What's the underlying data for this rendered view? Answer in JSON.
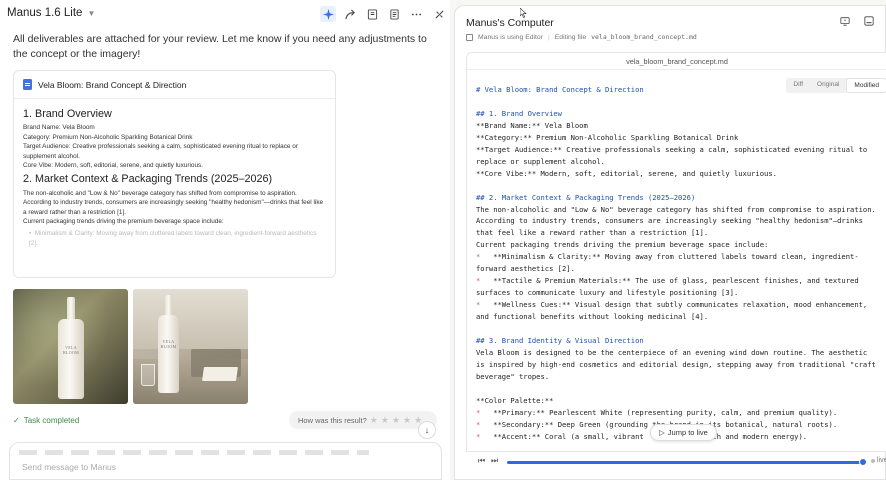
{
  "header": {
    "app_name": "Manus 1.6 Lite",
    "icons": [
      "sparkle-icon",
      "share-icon",
      "bookmark-icon",
      "document-icon",
      "more-icon",
      "collapse-icon"
    ]
  },
  "chat": {
    "message": "All deliverables are attached for your review. Let me know if you need any adjustments to the concept or the imagery!",
    "card": {
      "title": "Vela Bloom: Brand Concept & Direction",
      "sections": [
        {
          "heading": "1. Brand Overview",
          "lines": [
            "Brand Name: Vela Bloom",
            "Category: Premium Non-Alcoholic Sparkling Botanical Drink",
            "Target Audience: Creative professionals seeking a calm, sophisticated evening ritual to replace or supplement alcohol.",
            "Core Vibe: Modern, soft, editorial, serene, and quietly luxurious."
          ]
        },
        {
          "heading": "2. Market Context & Packaging Trends (2025–2026)",
          "lines": [
            "The non-alcoholic and \"Low & No\" beverage category has shifted from compromise to aspiration. According to industry trends, consumers are increasingly seeking \"healthy hedonism\"—drinks that feel like a reward rather than a restriction [1].",
            "Current packaging trends driving the premium beverage space include:"
          ],
          "fade_line": "Minimalism & Clarity: Moving away from cluttered labels toward clean, ingredient-forward aesthetics [2]."
        }
      ]
    },
    "bottle_label": "VELA BLOOM",
    "status": "Task completed",
    "rating_prompt": "How was this result?",
    "stars": 5,
    "composer_placeholder": "Send message to Manus"
  },
  "computer": {
    "title": "Manus's Computer",
    "status_app": "Manus is using Editor",
    "status_action": "Editing file",
    "status_file": "vela_bloom_brand_concept.md",
    "file_name": "vela_bloom_brand_concept.md",
    "tabs": [
      "Diff",
      "Original",
      "Modified"
    ],
    "active_tab": "Modified",
    "code_lines": [
      {
        "t": "# Vela Bloom: Brand Concept & Direction",
        "c": "h"
      },
      {
        "t": "",
        "c": ""
      },
      {
        "t": "## 1. Brand Overview",
        "c": "h"
      },
      {
        "t": "**Brand Name:** Vela Bloom",
        "c": ""
      },
      {
        "t": "**Category:** Premium Non-Alcoholic Sparkling Botanical Drink",
        "c": ""
      },
      {
        "t": "**Target Audience:** Creative professionals seeking a calm, sophisticated evening ritual to",
        "c": ""
      },
      {
        "t": "replace or supplement alcohol.",
        "c": ""
      },
      {
        "t": "**Core Vibe:** Modern, soft, editorial, serene, and quietly luxurious.",
        "c": ""
      },
      {
        "t": "",
        "c": ""
      },
      {
        "t": "## 2. Market Context & Packaging Trends (2025–2026)",
        "c": "h"
      },
      {
        "t": "The non-alcoholic and \"Low & No\" beverage category has shifted from compromise to aspiration.",
        "c": ""
      },
      {
        "t": "According to industry trends, consumers are increasingly seeking \"healthy hedonism\"—drinks",
        "c": ""
      },
      {
        "t": "that feel like a reward rather than a restriction [1].",
        "c": ""
      },
      {
        "t": "Current packaging trends driving the premium beverage space include:",
        "c": ""
      },
      {
        "t": "*   **Minimalism & Clarity:** Moving away from cluttered labels toward clean, ingredient-",
        "c": "bl"
      },
      {
        "t": "forward aesthetics [2].",
        "c": ""
      },
      {
        "t": "*   **Tactile & Premium Materials:** The use of glass, pearlescent finishes, and textured",
        "c": "bl"
      },
      {
        "t": "surfaces to communicate luxury and lifestyle positioning [3].",
        "c": ""
      },
      {
        "t": "*   **Wellness Cues:** Visual design that subtly communicates relaxation, mood enhancement,",
        "c": "bl"
      },
      {
        "t": "and functional benefits without looking medicinal [4].",
        "c": ""
      },
      {
        "t": "",
        "c": ""
      },
      {
        "t": "## 3. Brand Identity & Visual Direction",
        "c": "h"
      },
      {
        "t": "Vela Bloom is designed to be the centerpiece of an evening wind down routine. The aesthetic",
        "c": ""
      },
      {
        "t": "is inspired by high-end cosmetics and editorial design, stepping away from traditional \"craft",
        "c": ""
      },
      {
        "t": "beverage\" tropes.",
        "c": ""
      },
      {
        "t": "",
        "c": ""
      },
      {
        "t": "**Color Palette:**",
        "c": ""
      },
      {
        "t": "*   **Primary:** Pearlescent White (representing purity, calm, and premium quality).",
        "c": "bl"
      },
      {
        "t": "*   **Secondary:** Deep Green (grounding the brand in its botanical, natural roots).",
        "c": "bl"
      },
      {
        "t": "*   **Accent:** Coral (a small, vibrant                th and modern energy).",
        "c": "bl"
      }
    ],
    "jump_label": "Jump to live",
    "live_label": "live"
  },
  "colors": {
    "accent": "#2a6de0",
    "heading_code": "#1f4fb0",
    "bullet": "#d2584a",
    "success": "#3f8a4a"
  }
}
